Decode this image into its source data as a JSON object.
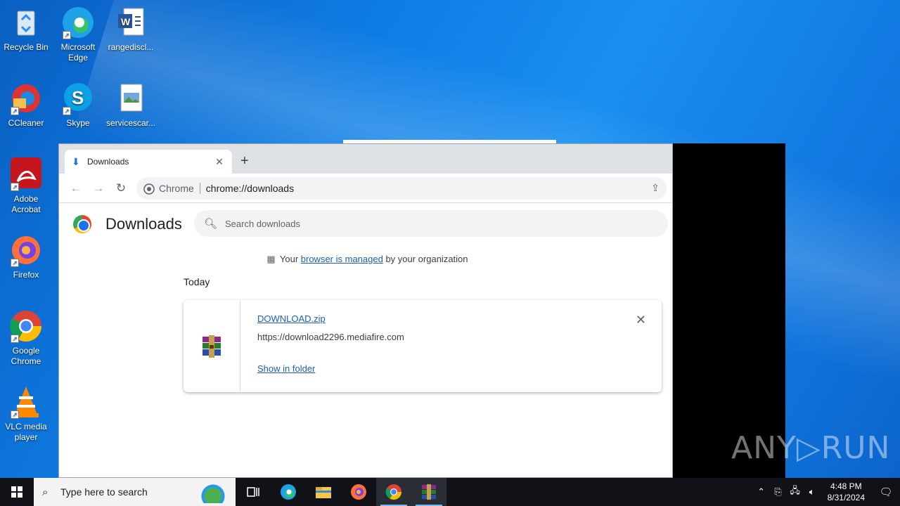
{
  "desktop": {
    "icons": [
      {
        "label": "Recycle Bin"
      },
      {
        "label": "Microsoft Edge"
      },
      {
        "label": "rangediscl..."
      },
      {
        "label": "CCleaner"
      },
      {
        "label": "Skype"
      },
      {
        "label": "servicescar..."
      },
      {
        "label": "Adobe Acrobat"
      },
      {
        "label": "Firefox"
      },
      {
        "label": "Google Chrome"
      },
      {
        "label": "VLC media player"
      }
    ]
  },
  "browser": {
    "tab": {
      "title": "Downloads",
      "close": "✕",
      "new_tab": "+"
    },
    "omnibox": {
      "chip": "Chrome",
      "url": "chrome://downloads"
    },
    "page": {
      "title": "Downloads",
      "search_placeholder": "Search downloads",
      "managed": {
        "prefix": "Your ",
        "link": "browser is managed",
        "suffix": " by your organization"
      },
      "section": "Today",
      "download": {
        "filename": "DOWNLOAD.zip",
        "url": "https://download2296.mediafire.com",
        "action": "Show in folder",
        "remove": "✕"
      }
    }
  },
  "watermark": "ANY▷RUN",
  "taskbar": {
    "search_placeholder": "Type here to search",
    "time": "4:48 PM",
    "date": "8/31/2024"
  }
}
